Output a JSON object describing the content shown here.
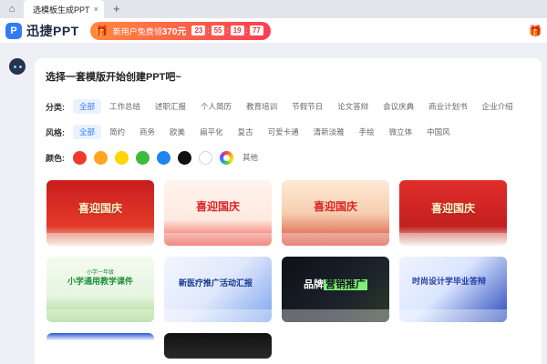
{
  "browser": {
    "tab_title": "选模板生成PPT",
    "close_glyph": "×",
    "new_tab_glyph": "+",
    "home_icon": "house-icon"
  },
  "header": {
    "logo_text": "迅捷PPT",
    "logo_mark": "P",
    "promo": {
      "text": "新用户免费领",
      "amount": "370元",
      "countdown": [
        "23",
        "55",
        "19",
        "77"
      ],
      "separator": ":"
    },
    "gift_icon": "gift-icon"
  },
  "panel": {
    "title": "选择一套模版开始创建PPT吧~",
    "category": {
      "label": "分类:",
      "items": [
        "全部",
        "工作总结",
        "述职汇报",
        "个人简历",
        "教育培训",
        "节假节日",
        "论文答辩",
        "会议庆典",
        "商业计划书",
        "企业介绍"
      ],
      "active_index": 0
    },
    "style": {
      "label": "风格:",
      "items": [
        "全部",
        "简约",
        "商务",
        "欧美",
        "扁平化",
        "复古",
        "可爱卡通",
        "清新淡雅",
        "手绘",
        "微立体",
        "中国风"
      ],
      "active_index": 0
    },
    "color": {
      "label": "颜色:",
      "swatches": [
        "#f03a2e",
        "#ffa51f",
        "#ffd600",
        "#3dbb3d",
        "#1f84f0",
        "#111111",
        "#ffffff"
      ],
      "more_label": "其他"
    }
  },
  "templates": [
    {
      "title": "喜迎国庆",
      "sub": "",
      "style": "c-red1",
      "title_style": "t-red"
    },
    {
      "title": "喜迎国庆",
      "sub": "",
      "style": "c-red2",
      "title_style": "t-dark-red"
    },
    {
      "title": "喜迎国庆",
      "sub": "",
      "style": "c-red3",
      "title_style": "t-dark-red"
    },
    {
      "title": "喜迎国庆",
      "sub": "",
      "style": "c-red4",
      "title_style": "t-red"
    },
    {
      "title": "小学通用教学课件",
      "sub": "小学一年级",
      "style": "c-green",
      "title_style": "t-green"
    },
    {
      "title": "新医疗推广活动汇报",
      "sub": "",
      "style": "c-blue",
      "title_style": "t-blue"
    },
    {
      "title": "品牌营销推广",
      "sub": "",
      "style": "c-dark",
      "title_style": "t-neon"
    },
    {
      "title": "时尚设计学毕业答辩",
      "sub": "",
      "style": "c-navy",
      "title_style": "t-navy"
    },
    {
      "title": "",
      "sub": "",
      "style": "c-partial1",
      "title_style": ""
    },
    {
      "title": "",
      "sub": "",
      "style": "c-partial2",
      "title_style": ""
    }
  ]
}
